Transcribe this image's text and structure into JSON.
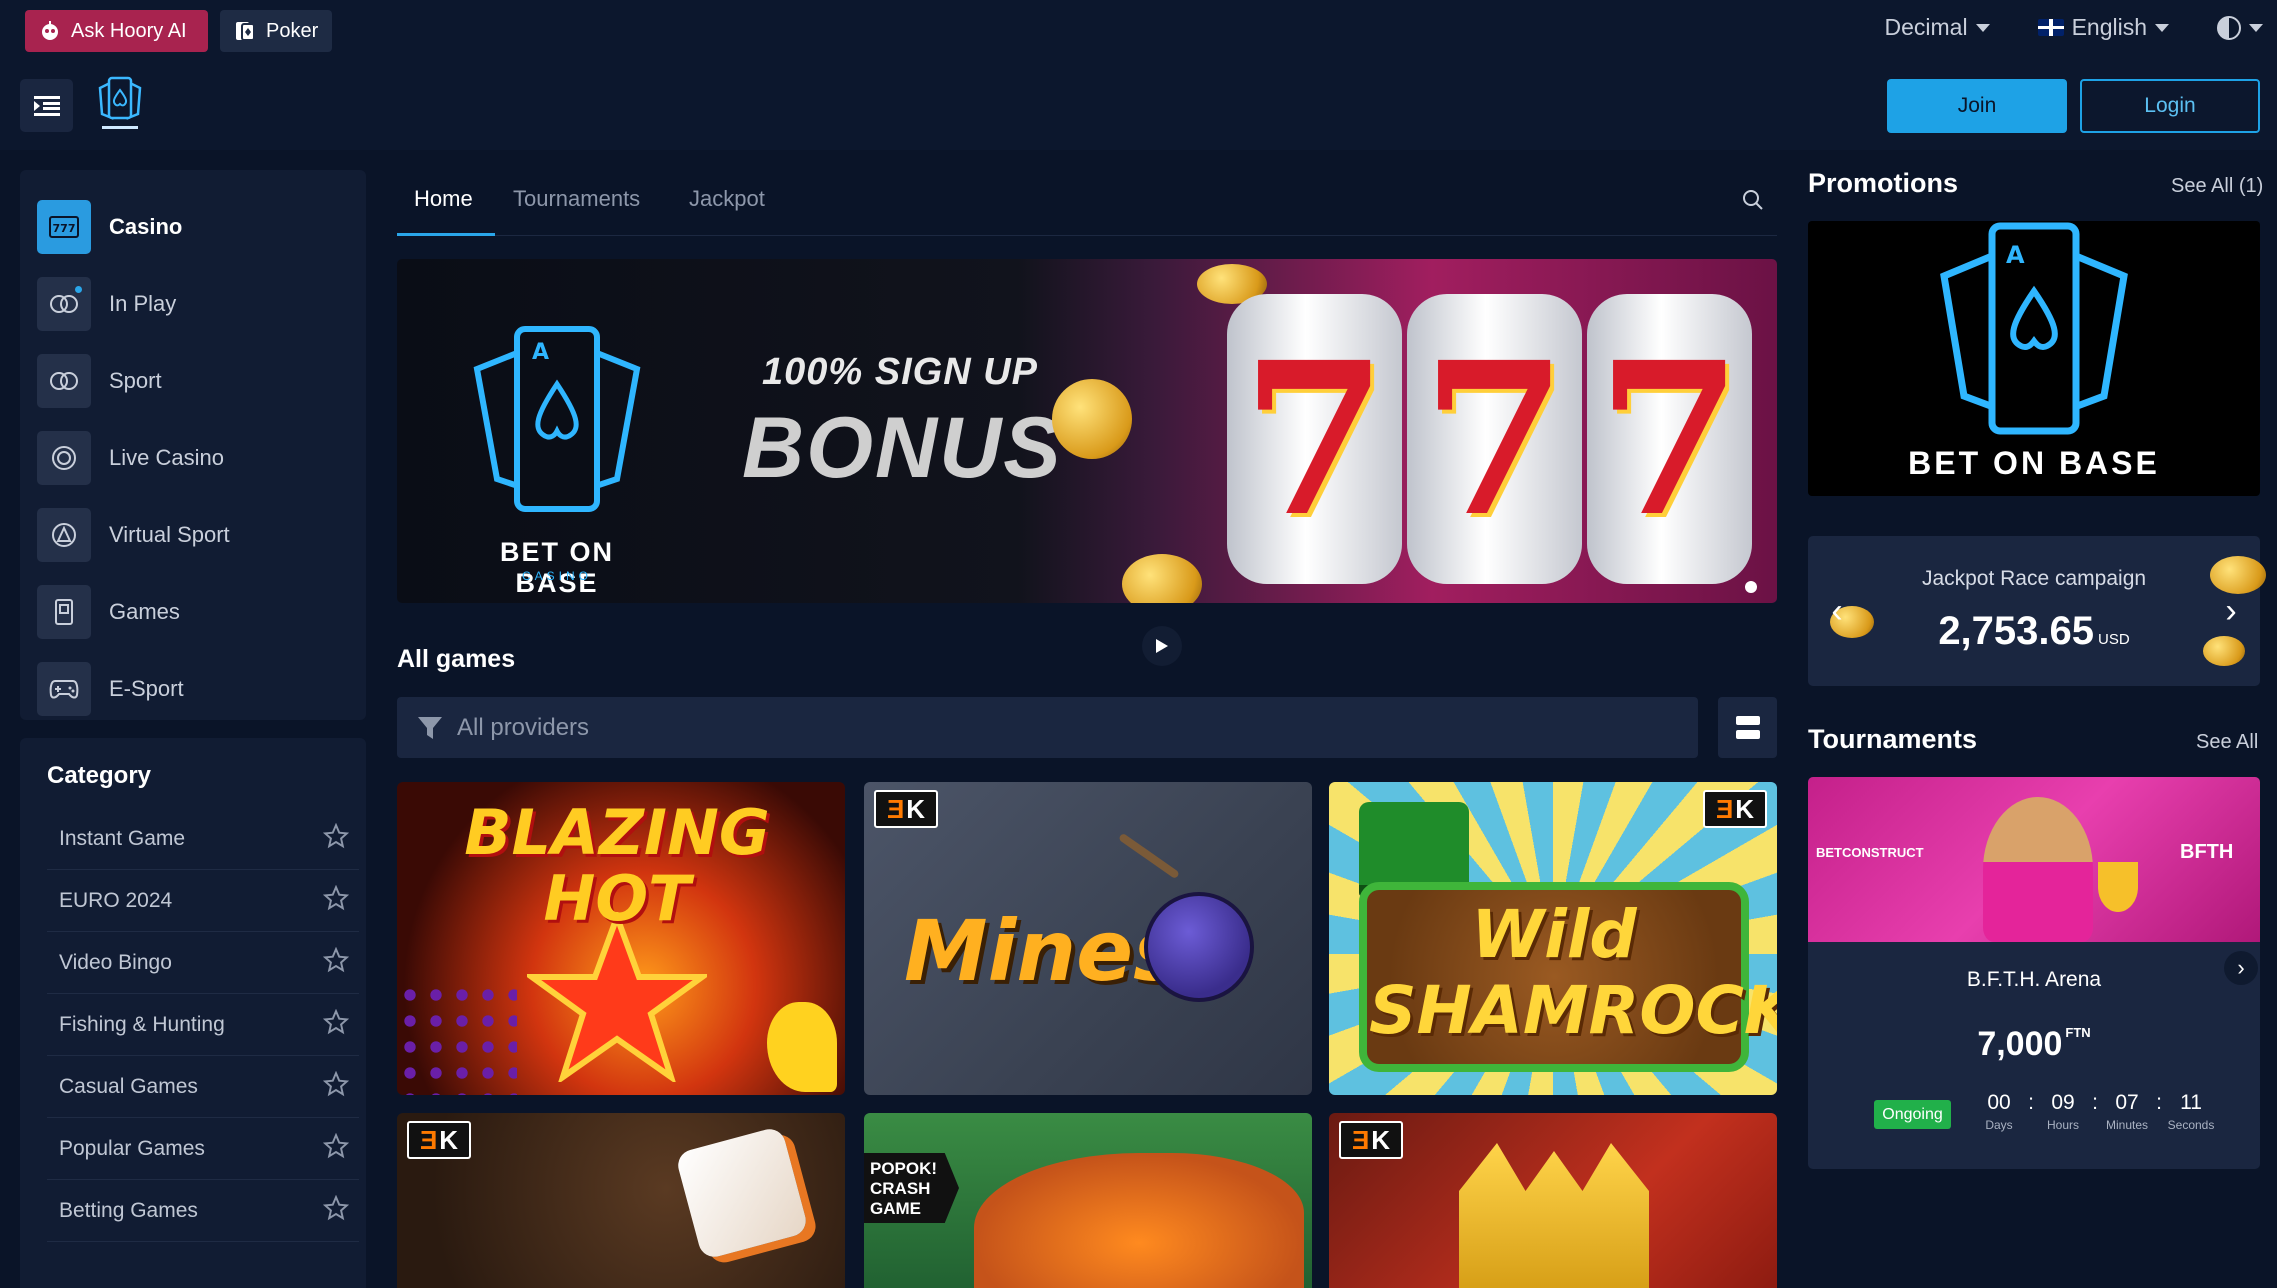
{
  "topbar": {
    "ask_label": "Ask Hoory AI",
    "poker_label": "Poker",
    "odds_format": "Decimal",
    "language": "English"
  },
  "header": {
    "join_label": "Join",
    "login_label": "Login"
  },
  "nav": {
    "items": [
      {
        "label": "Casino",
        "icon": "casino-icon"
      },
      {
        "label": "In Play",
        "icon": "in-play-icon"
      },
      {
        "label": "Sport",
        "icon": "sport-icon"
      },
      {
        "label": "Live Casino",
        "icon": "live-casino-icon"
      },
      {
        "label": "Virtual Sport",
        "icon": "virtual-sport-icon"
      },
      {
        "label": "Games",
        "icon": "games-icon"
      },
      {
        "label": "E-Sport",
        "icon": "esport-icon"
      }
    ]
  },
  "category": {
    "title": "Category",
    "items": [
      {
        "label": "Instant Game"
      },
      {
        "label": "EURO 2024"
      },
      {
        "label": "Video Bingo"
      },
      {
        "label": "Fishing & Hunting"
      },
      {
        "label": "Casual Games"
      },
      {
        "label": "Popular Games"
      },
      {
        "label": "Betting Games"
      }
    ]
  },
  "tabs": [
    {
      "label": "Home"
    },
    {
      "label": "Tournaments"
    },
    {
      "label": "Jackpot"
    }
  ],
  "banner": {
    "line1": "100% SIGN UP",
    "line2": "BONUS",
    "brand": "BET ON BASE",
    "brand_sub": "CASINO",
    "reel_symbol": "7"
  },
  "games": {
    "title": "All games",
    "providers_placeholder": "All providers",
    "tiles": [
      {
        "title": "BLAZING HOT"
      },
      {
        "title": "Mines"
      },
      {
        "title": "Wild SHAMROCK"
      },
      {
        "title": ""
      },
      {
        "title": "",
        "tag": "POPOK! CRASH GAME"
      },
      {
        "title": ""
      }
    ]
  },
  "promotions": {
    "title": "Promotions",
    "see_all": "See All (1)",
    "brand": "BET ON BASE"
  },
  "jackpot": {
    "title": "Jackpot Race campaign",
    "amount": "2,753.65",
    "currency": "USD"
  },
  "tournaments": {
    "title": "Tournaments",
    "see_all": "See All",
    "card": {
      "left_logo": "BETCONSTRUCT",
      "right_logo": "BFTH",
      "name": "B.F.T.H. Arena",
      "prize": "7,000",
      "prize_currency": "FTN",
      "status": "Ongoing",
      "timer": [
        {
          "value": "00",
          "label": "Days"
        },
        {
          "value": "09",
          "label": "Hours"
        },
        {
          "value": "07",
          "label": "Minutes"
        },
        {
          "value": "11",
          "label": "Seconds"
        }
      ]
    }
  },
  "colors": {
    "accent": "#1ea2e6",
    "background": "#0a1428",
    "panel": "#111c33",
    "ask_pill": "#a8234f",
    "ongoing": "#21b04a"
  }
}
